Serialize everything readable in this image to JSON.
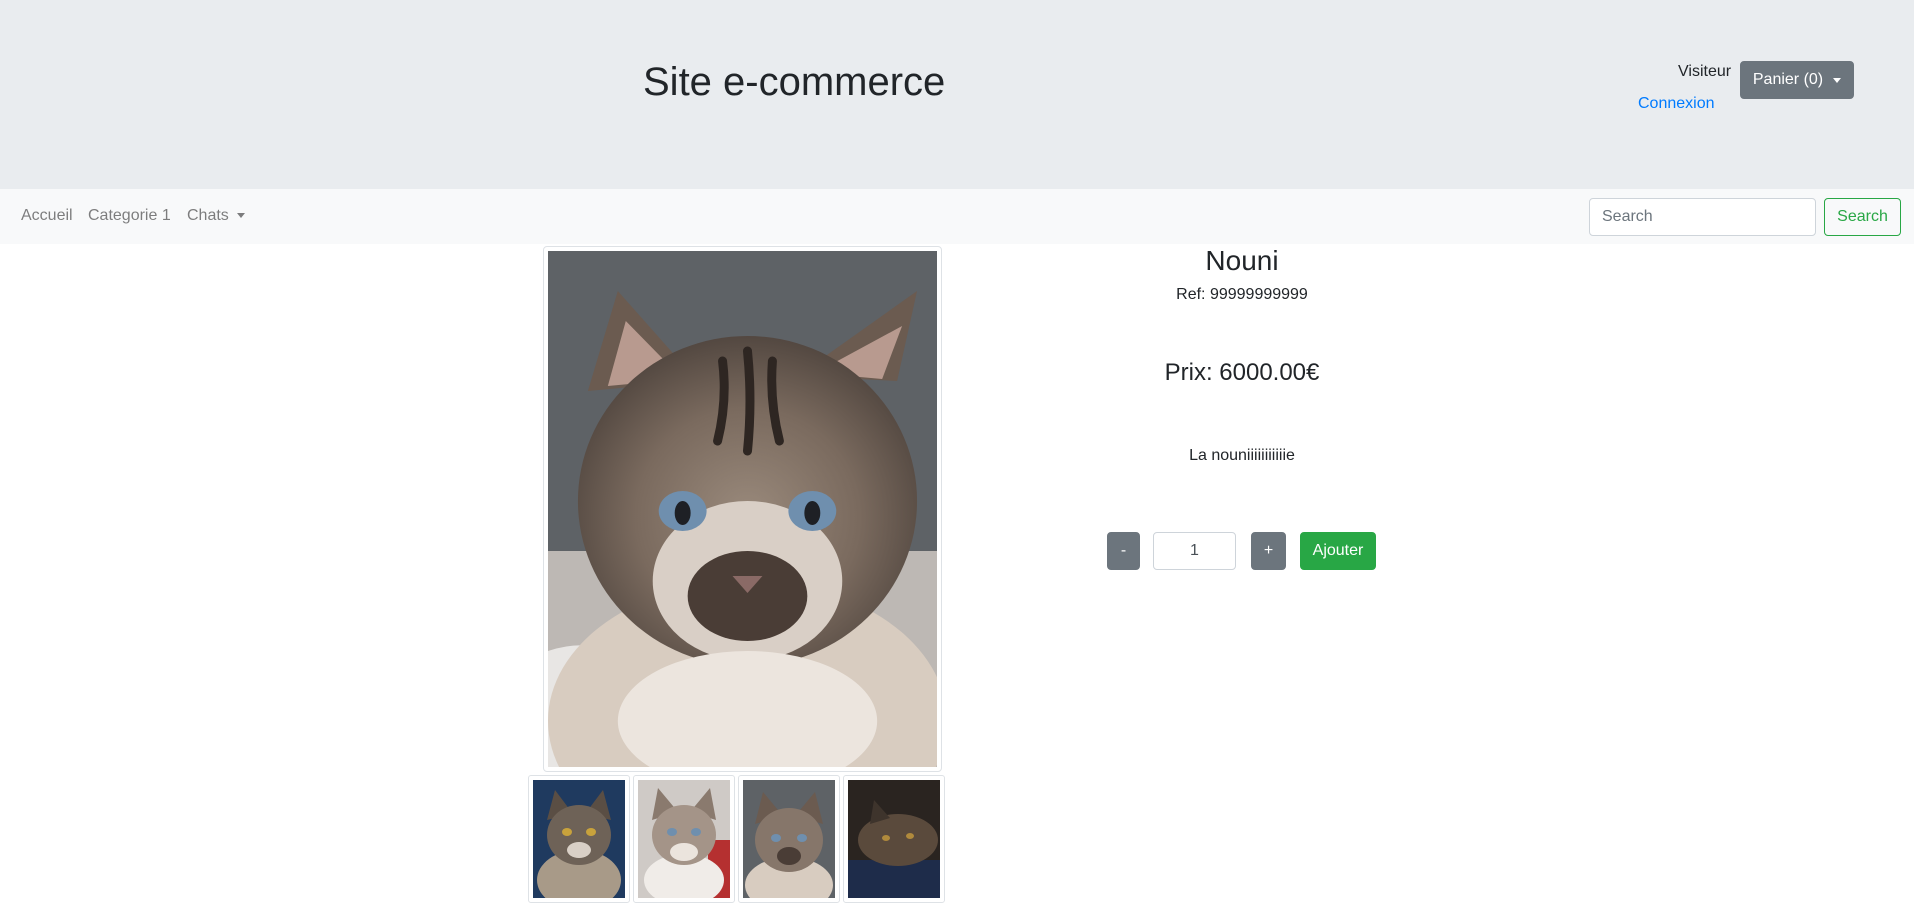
{
  "header": {
    "title": "Site e-commerce",
    "visitor_label": "Visiteur",
    "login_link": "Connexion",
    "cart_button": "Panier (0)"
  },
  "navbar": {
    "items": [
      {
        "label": "Accueil"
      },
      {
        "label": "Categorie 1"
      },
      {
        "label": "Chats",
        "dropdown": true
      }
    ],
    "search": {
      "placeholder": "Search",
      "value": "",
      "button": "Search"
    }
  },
  "product": {
    "name": "Nouni",
    "ref": "Ref: 99999999999",
    "price": "Prix: 6000.00€",
    "description": "La nouniiiiiiiiiiie",
    "quantity": "1",
    "minus_label": "-",
    "plus_label": "+",
    "add_label": "Ajouter"
  },
  "gallery": {
    "main_image": "cat-photo-main",
    "thumbnails": [
      "cat-photo-thumb-1",
      "cat-photo-thumb-2",
      "cat-photo-thumb-3",
      "cat-photo-thumb-4"
    ]
  },
  "colors": {
    "header_bg": "#e9ecef",
    "navbar_bg": "#f8f9fa",
    "primary_link": "#007bff",
    "secondary_btn": "#6c757d",
    "success": "#28a745"
  }
}
